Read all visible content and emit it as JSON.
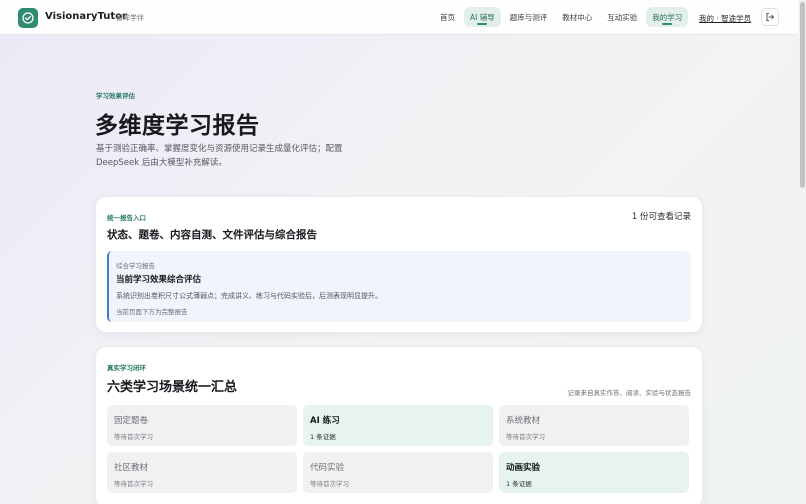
{
  "header": {
    "brand": "VisionaryTutor",
    "brand_sub": "智眸学伴",
    "nav": [
      {
        "label": "首页",
        "active": false
      },
      {
        "label": "AI 辅导",
        "active": true
      },
      {
        "label": "题库与测评",
        "active": false
      },
      {
        "label": "教材中心",
        "active": false
      },
      {
        "label": "互动实验",
        "active": false
      },
      {
        "label": "我的学习",
        "active": true
      }
    ],
    "user_link": "我的 · 智途学员"
  },
  "hero": {
    "eyebrow": "学习效果评估",
    "title": "多维度学习报告",
    "description": "基于测验正确率、掌握度变化与资源使用记录生成量化评估；配置 DeepSeek 后由大模型补充解读。"
  },
  "report_card": {
    "eyebrow": "统一报告入口",
    "title": "状态、题卷、内容自测、文件评估与综合报告",
    "count": "1 份可查看记录",
    "report": {
      "tag": "综合学习报告",
      "title": "当前学习效果综合评估",
      "description": "系统识别出卷积尺寸公式薄弱点；完成讲义、练习与代码实验后，后测表现明显提升。",
      "note": "当前页面下方为完整报告"
    }
  },
  "scenes_card": {
    "eyebrow": "真实学习闭环",
    "title": "六类学习场景统一汇总",
    "side_note": "记录来自真实作答、阅读、实验与状态报告",
    "tiles": [
      {
        "name": "固定题卷",
        "status": "等待首次学习",
        "active": false
      },
      {
        "name": "AI 练习",
        "status": "1 条证据",
        "active": true
      },
      {
        "name": "系统教材",
        "status": "等待首次学习",
        "active": false
      },
      {
        "name": "社区教材",
        "status": "等待首次学习",
        "active": false
      },
      {
        "name": "代码实验",
        "status": "等待首次学习",
        "active": false
      },
      {
        "name": "动画实验",
        "status": "1 条证据",
        "active": true
      }
    ]
  },
  "colors": {
    "accent": "#2e8a70",
    "report_border": "#3d7bd1"
  }
}
